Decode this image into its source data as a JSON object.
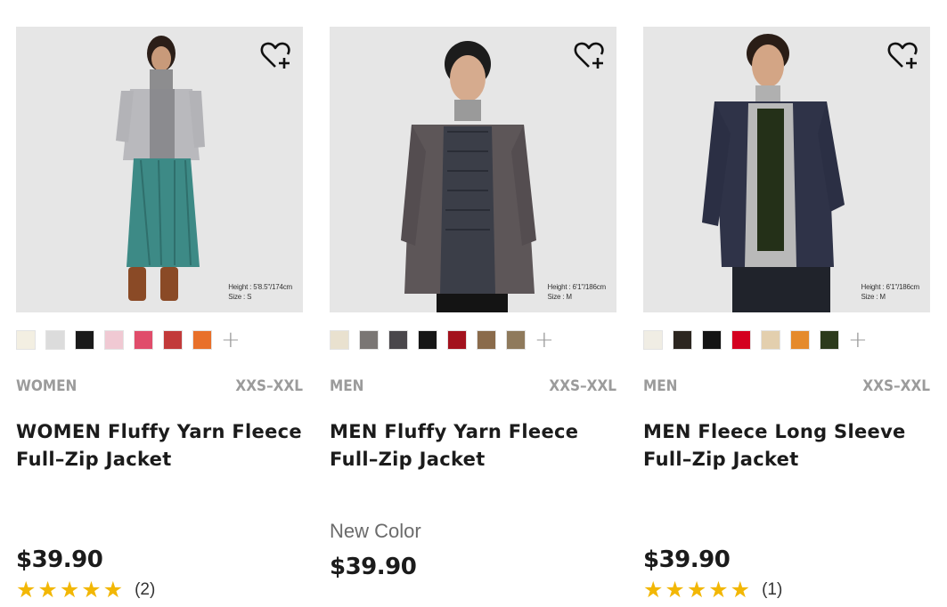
{
  "products": [
    {
      "photo_caption": [
        "Height : 5'8.5\"/174cm",
        "Size : S"
      ],
      "swatches": [
        "#f3efe2",
        "#dcdcdc",
        "#1a1a1a",
        "#f0c9d3",
        "#e04d6b",
        "#c23a3a",
        "#e8702a"
      ],
      "gender": "WOMEN",
      "sizes": "XXS–XXL",
      "name": "WOMEN Fluffy Yarn Fleece Full–Zip Jacket",
      "tag": "",
      "price": "$39.90",
      "stars": "★★★★★",
      "review_count": "(2)"
    },
    {
      "photo_caption": [
        "Height : 6'1\"/186cm",
        "Size : M"
      ],
      "swatches": [
        "#e9e1cf",
        "#7a7674",
        "#4a474b",
        "#161616",
        "#a3121d",
        "#8a6b4b",
        "#8f7a5c"
      ],
      "gender": "MEN",
      "sizes": "XXS–XXL",
      "name": "MEN Fluffy Yarn Fleece Full–Zip Jacket",
      "tag": "New Color",
      "price": "$39.90",
      "stars": "",
      "review_count": ""
    },
    {
      "photo_caption": [
        "Height : 6'1\"/186cm",
        "Size : M"
      ],
      "swatches": [
        "#f0ede4",
        "#2c2620",
        "#141414",
        "#d4001f",
        "#e3cfae",
        "#e58a2b",
        "#2c3a1c"
      ],
      "gender": "MEN",
      "sizes": "XXS–XXL",
      "name": "MEN Fleece Long Sleeve Full–Zip Jacket",
      "tag": "",
      "price": "$39.90",
      "stars": "★★★★★",
      "review_count": "(1)"
    }
  ],
  "more_colors_glyph": "+",
  "colors": {
    "star": "#f2b705",
    "meta_gray": "#9b9b9b",
    "text": "#1b1b1b"
  }
}
